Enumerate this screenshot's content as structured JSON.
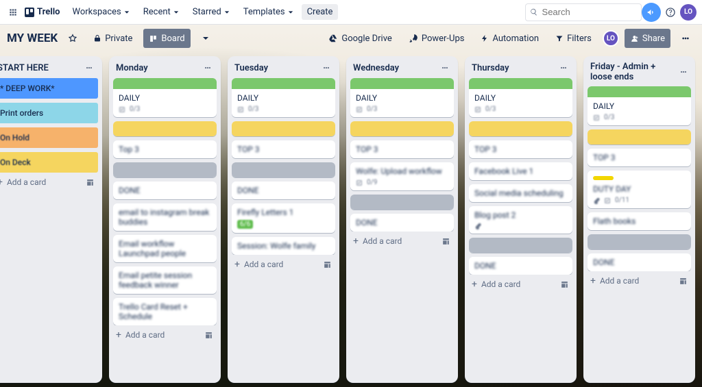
{
  "nav": {
    "logo": "Trello",
    "workspaces": "Workspaces",
    "recent": "Recent",
    "starred": "Starred",
    "templates": "Templates",
    "create": "Create",
    "search_placeholder": "Search",
    "avatar_initials": "LO"
  },
  "board_bar": {
    "title": "MY WEEK",
    "private": "Private",
    "board_view": "Board",
    "google_drive": "Google Drive",
    "power_ups": "Power-Ups",
    "automation": "Automation",
    "filters": "Filters",
    "member_initials": "LO",
    "share": "Share"
  },
  "lists": [
    {
      "title": "START HERE",
      "kind": "start",
      "cards": [
        {
          "type": "colorblock",
          "color": "blue",
          "sharp": true,
          "title": "* DEEP WORK*"
        },
        {
          "type": "colorblock",
          "color": "teal",
          "sharp": true,
          "title": "Print orders"
        },
        {
          "type": "colorblock",
          "color": "orange",
          "sharp": false,
          "title": "On Hold"
        },
        {
          "type": "colorblock",
          "color": "yellow",
          "sharp": false,
          "title": "On Deck"
        }
      ],
      "add_card": "Add a card"
    },
    {
      "title": "Monday",
      "kind": "day",
      "cards": [
        {
          "type": "covered",
          "cover": "green",
          "title": "DAILY",
          "sharp": true,
          "checklist": "0/3"
        },
        {
          "type": "labelbar",
          "cover": "yellow"
        },
        {
          "type": "plain",
          "title": "Top 3",
          "sharp": false
        },
        {
          "type": "labelbar",
          "cover": "grey"
        },
        {
          "type": "plain",
          "title": "DONE",
          "sharp": false
        },
        {
          "type": "plain",
          "title": "email to instagram break buddies",
          "sharp": false
        },
        {
          "type": "plain",
          "title": "Email workflow Launchpad people",
          "sharp": false
        },
        {
          "type": "plain",
          "title": "Email petite session feedback winner",
          "sharp": false
        },
        {
          "type": "plain",
          "title": "Trello Card Reset + Schedule",
          "sharp": false
        }
      ],
      "add_card": "Add a card"
    },
    {
      "title": "Tuesday",
      "kind": "day",
      "cards": [
        {
          "type": "covered",
          "cover": "green",
          "title": "DAILY",
          "sharp": true,
          "checklist": "0/3"
        },
        {
          "type": "labelbar",
          "cover": "yellow"
        },
        {
          "type": "plain",
          "title": "TOP 3",
          "sharp": false
        },
        {
          "type": "labelbar",
          "cover": "grey"
        },
        {
          "type": "plain",
          "title": "DONE",
          "sharp": false
        },
        {
          "type": "plain",
          "title": "Firefly Letters 1",
          "sharp": false,
          "pill": "6/6"
        },
        {
          "type": "plain",
          "title": "Session: Wolfe family",
          "sharp": false
        }
      ],
      "add_card": "Add a card"
    },
    {
      "title": "Wednesday",
      "kind": "day",
      "cards": [
        {
          "type": "covered",
          "cover": "green",
          "title": "DAILY",
          "sharp": true,
          "checklist": "0/3"
        },
        {
          "type": "labelbar",
          "cover": "yellow"
        },
        {
          "type": "plain",
          "title": "TOP 3",
          "sharp": false
        },
        {
          "type": "plain",
          "title": "Wolfe: Upload workflow",
          "sharp": false,
          "checklist": "0/9"
        },
        {
          "type": "labelbar",
          "cover": "grey"
        },
        {
          "type": "plain",
          "title": "DONE",
          "sharp": false
        }
      ],
      "add_card": "Add a card"
    },
    {
      "title": "Thursday",
      "kind": "day",
      "cards": [
        {
          "type": "covered",
          "cover": "green",
          "title": "DAILY",
          "sharp": true,
          "checklist": "0/3"
        },
        {
          "type": "labelbar",
          "cover": "yellow"
        },
        {
          "type": "plain",
          "title": "TOP 3",
          "sharp": false
        },
        {
          "type": "plain",
          "title": "Facebook Live 1",
          "sharp": false
        },
        {
          "type": "plain",
          "title": "Social media scheduling",
          "sharp": false
        },
        {
          "type": "plain",
          "title": "Blog post 2",
          "sharp": false,
          "attach": true
        },
        {
          "type": "labelbar",
          "cover": "grey"
        },
        {
          "type": "plain",
          "title": "DONE",
          "sharp": false
        }
      ],
      "add_card": "Add a card"
    },
    {
      "title": "Friday - Admin + loose ends",
      "kind": "day",
      "cards": [
        {
          "type": "covered",
          "cover": "green",
          "title": "DAILY",
          "sharp": true,
          "checklist": "0/3"
        },
        {
          "type": "labelbar",
          "cover": "yellow"
        },
        {
          "type": "plain",
          "title": "TOP 3",
          "sharp": false
        },
        {
          "type": "plain",
          "title": "DUTY DAY",
          "sharp": false,
          "mini_label": true,
          "attach": true,
          "checklist": "0/11"
        },
        {
          "type": "plain",
          "title": "Flath books",
          "sharp": false
        },
        {
          "type": "labelbar",
          "cover": "grey"
        },
        {
          "type": "plain",
          "title": "DONE",
          "sharp": false
        }
      ],
      "add_card": "Add a card"
    }
  ]
}
